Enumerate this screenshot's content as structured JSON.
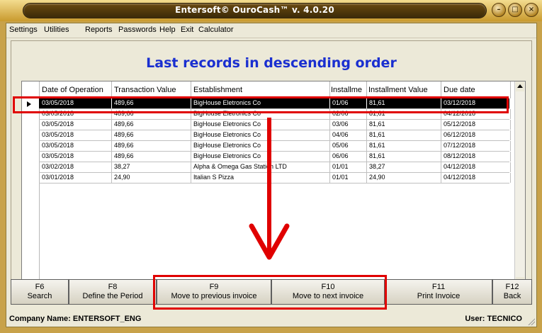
{
  "window": {
    "title": "Entersoft© OuroCash™ v. 4.0.20",
    "accent": "#c8a24a",
    "buttons": [
      {
        "icon": "minimize-icon",
        "glyph": "–"
      },
      {
        "icon": "maximize-icon",
        "glyph": "□"
      },
      {
        "icon": "close-icon",
        "glyph": "×"
      }
    ]
  },
  "menu": [
    "Settings",
    "Utilities",
    "Reports",
    "Passwords",
    "Help",
    "Exit",
    "Calculator"
  ],
  "heading": "Last records in descending order",
  "heading_color": "#1a2fd0",
  "grid": {
    "columns": [
      "Date of Operation",
      "Transaction Value",
      "Establishment",
      "Installme",
      "Installment Value",
      "Due date"
    ],
    "rows": [
      [
        "03/05/2018",
        "489,66",
        "BigHouse Eletronics Co",
        "01/06",
        "81,61",
        "03/12/2018"
      ],
      [
        "03/05/2018",
        "489,66",
        "BigHouse Eletronics Co",
        "02/06",
        "81,61",
        "04/12/2018"
      ],
      [
        "03/05/2018",
        "489,66",
        "BigHouse Eletronics Co",
        "03/06",
        "81,61",
        "05/12/2018"
      ],
      [
        "03/05/2018",
        "489,66",
        "BigHouse Eletronics Co",
        "04/06",
        "81,61",
        "06/12/2018"
      ],
      [
        "03/05/2018",
        "489,66",
        "BigHouse Eletronics Co",
        "05/06",
        "81,61",
        "07/12/2018"
      ],
      [
        "03/05/2018",
        "489,66",
        "BigHouse Eletronics Co",
        "06/06",
        "81,61",
        "08/12/2018"
      ],
      [
        "03/02/2018",
        "38,27",
        "Alpha & Omega Gas Station LTD",
        "01/01",
        "38,27",
        "04/12/2018"
      ],
      [
        "03/01/2018",
        "24,90",
        "Italian S Pizza",
        "01/01",
        "24,90",
        "04/12/2018"
      ]
    ],
    "selected_row": 0
  },
  "function_keys": [
    {
      "key": "F6",
      "label": "Search"
    },
    {
      "key": "F8",
      "label": "Define the Period"
    },
    {
      "key": "F9",
      "label": "Move to previous invoice"
    },
    {
      "key": "F10",
      "label": "Move to next invoice"
    },
    {
      "key": "F11",
      "label": "Print Invoice"
    },
    {
      "key": "F12",
      "label": "Back"
    }
  ],
  "status": {
    "company": "Company Name: ENTERSOFT_ENG",
    "user": "User: TECNICO"
  },
  "annotation_color": "#e00000"
}
